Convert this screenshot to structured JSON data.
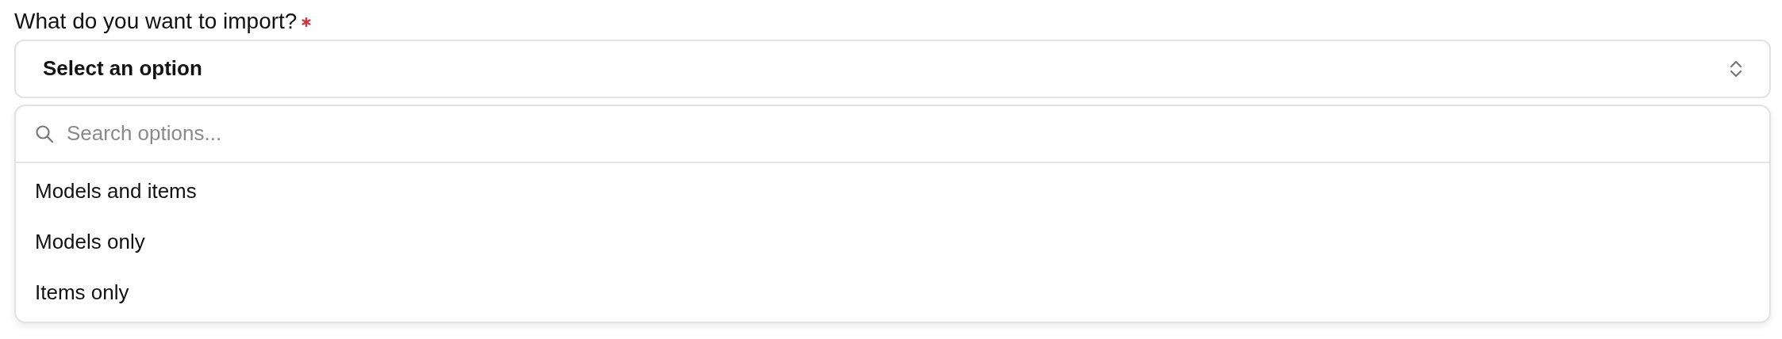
{
  "field": {
    "label": "What do you want to import?",
    "required": true,
    "value": "Select an option"
  },
  "dropdown": {
    "search": {
      "placeholder": "Search options..."
    },
    "options": [
      {
        "label": "Models and items",
        "selected": false
      },
      {
        "label": "Models only",
        "selected": false
      },
      {
        "label": "Items only",
        "selected": false
      }
    ]
  }
}
